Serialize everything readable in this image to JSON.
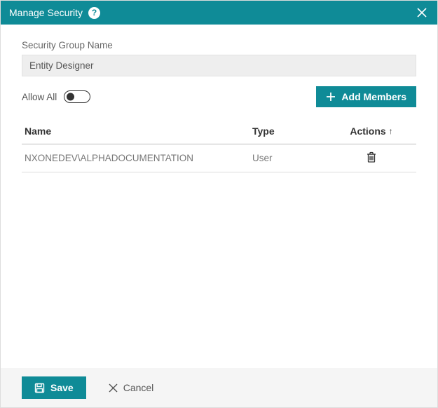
{
  "header": {
    "title": "Manage Security",
    "help_tooltip": "?",
    "close_label": "Close"
  },
  "form": {
    "group_name_label": "Security Group Name",
    "group_name_value": "Entity Designer",
    "allow_all_label": "Allow All",
    "allow_all_state": false,
    "add_members_label": "Add Members"
  },
  "table": {
    "columns": {
      "name": "Name",
      "type": "Type",
      "actions": "Actions"
    },
    "sort_indicator": "↑",
    "rows": [
      {
        "name": "NXONEDEV\\ALPHADOCUMENTATION",
        "type": "User"
      }
    ]
  },
  "footer": {
    "save_label": "Save",
    "cancel_label": "Cancel"
  }
}
